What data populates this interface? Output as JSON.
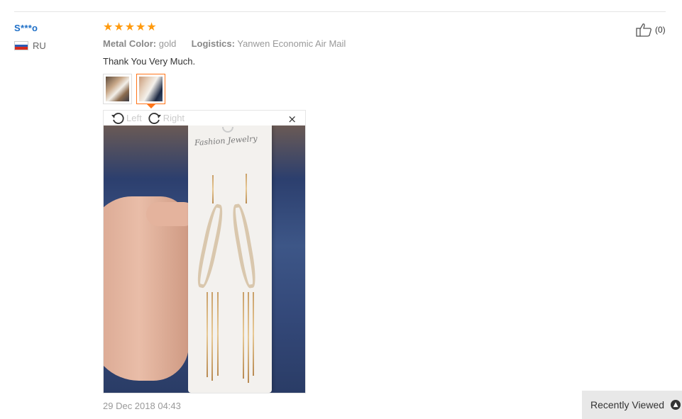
{
  "review": {
    "user": {
      "name": "S***o",
      "country": "RU",
      "flag_icon": "russia-flag-icon"
    },
    "rating": 5,
    "stars": [
      "★",
      "★",
      "★",
      "★",
      "★"
    ],
    "attributes": [
      {
        "key": "Metal Color:",
        "value": "gold"
      },
      {
        "key": "Logistics:",
        "value": "Yanwen Economic Air Mail"
      }
    ],
    "text": "Thank You Very Much.",
    "thumbnails": [
      "photo-1",
      "photo-2"
    ],
    "active_thumbnail": 1,
    "date": "29 Dec 2018 04:43",
    "helpful": {
      "icon": "thumbs-up-icon",
      "count_label": "(0)"
    }
  },
  "viewer": {
    "rotate_left_label": "Left",
    "rotate_right_label": "Right",
    "close_glyph": "×",
    "card_text": "Fashion Jewelry"
  },
  "recently_viewed": {
    "label": "Recently Viewed",
    "icon": "chevron-up-icon",
    "glyph": "▲"
  },
  "colors": {
    "user_link": "#1e6fc7",
    "star": "#ff9a0e",
    "active_border": "#ff7519",
    "muted_text": "#999999"
  }
}
